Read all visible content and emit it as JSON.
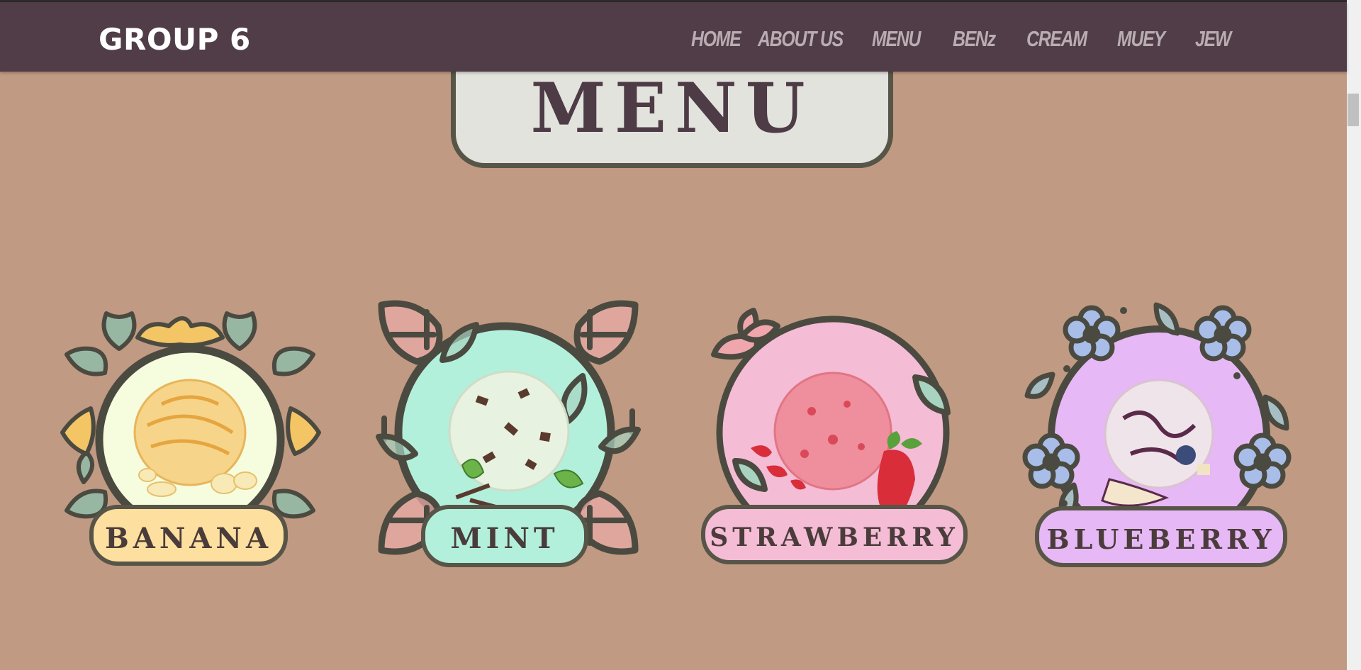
{
  "brand": "GROUP 6",
  "nav": [
    "HOME",
    "ABOUT US",
    "MENU",
    "BENz",
    "CREAM",
    "MUEY",
    "JEW"
  ],
  "page_title": "MENU",
  "flavors": [
    {
      "label": "BANANA",
      "bg": "#f6fcde",
      "label_bg": "#fde09f",
      "scoop": "#f6d48a",
      "accent": "#f3c565"
    },
    {
      "label": "MINT",
      "bg": "#b2f0dc",
      "label_bg": "#b2f0dc",
      "scoop": "#e8f2e0",
      "accent": "#5b3a2e"
    },
    {
      "label": "STRAWBERRY",
      "bg": "#f4bcd5",
      "label_bg": "#f4bcd5",
      "scoop": "#ef8e9c",
      "accent": "#d92d3a"
    },
    {
      "label": "BLUEBERRY",
      "bg": "#e6b8f5",
      "label_bg": "#e6b8f5",
      "scoop": "#efe4ea",
      "accent": "#5a2a4a"
    }
  ],
  "colors": {
    "background": "#c09a82",
    "navbar": "#503d47",
    "outline": "#575548",
    "leaf": "#98b7a2",
    "petal": "#a8bde8"
  }
}
